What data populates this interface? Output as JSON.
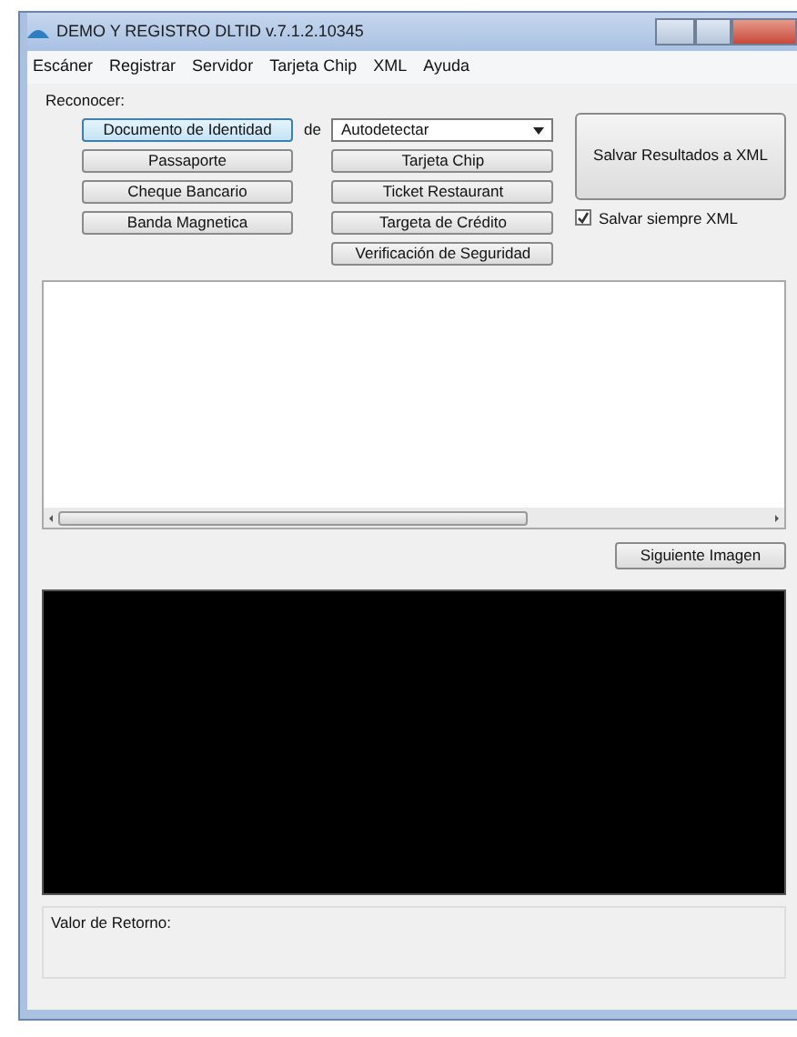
{
  "window": {
    "title": "DEMO Y REGISTRO DLTID v.7.1.2.10345"
  },
  "menu": [
    "Escáner",
    "Registrar",
    "Servidor",
    "Tarjeta Chip",
    "XML",
    "Ayuda"
  ],
  "recognize": {
    "label": "Reconocer:",
    "connector": "de",
    "dropdown": {
      "value": "Autodetectar"
    },
    "left_buttons": [
      {
        "label": "Documento de Identidad",
        "selected": true
      },
      {
        "label": "Passaporte",
        "selected": false
      },
      {
        "label": "Cheque Bancario",
        "selected": false
      },
      {
        "label": "Banda Magnetica",
        "selected": false
      }
    ],
    "right_buttons": [
      {
        "label": "Tarjeta Chip",
        "selected": false
      },
      {
        "label": "Ticket Restaurant",
        "selected": false
      },
      {
        "label": "Targeta de Crédito",
        "selected": false
      },
      {
        "label": "Verificación de Seguridad",
        "selected": false
      }
    ]
  },
  "save": {
    "button": "Salvar Resultados a XML",
    "checkbox": {
      "label": "Salvar siempre XML",
      "checked": true
    }
  },
  "next_button": "Siguiente Imagen",
  "return_value": {
    "label": "Valor de Retorno:"
  }
}
